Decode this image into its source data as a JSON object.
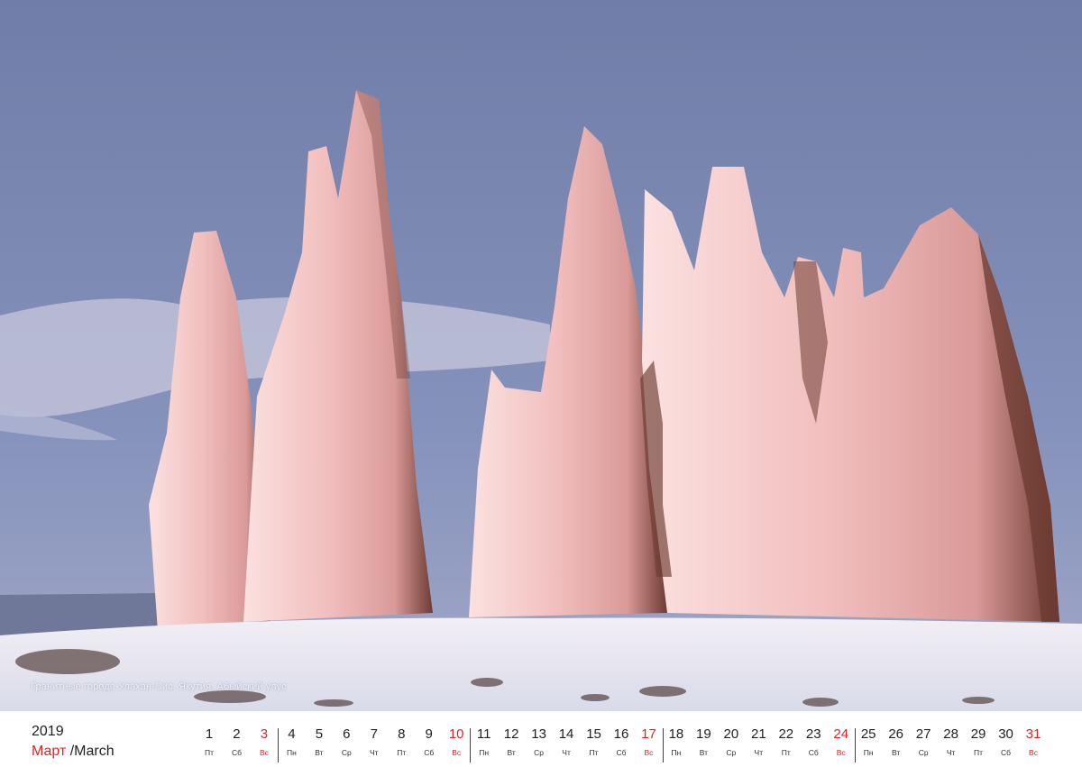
{
  "photo": {
    "caption": "Гранитные города Улахан-Сис. Якутия. Абыйский улус",
    "colors": {
      "sky": "#7f8cb4",
      "rock_lit": "#f3c4c4",
      "rock_dark": "#6b3a30",
      "snow": "#e8e8f2"
    }
  },
  "calendar": {
    "year": "2019",
    "month_ru": "Март",
    "month_en": "/March",
    "accent_color": "#d6262c",
    "days": [
      {
        "num": "1",
        "dow": "Пт"
      },
      {
        "num": "2",
        "dow": "Сб"
      },
      {
        "num": "3",
        "dow": "Вс"
      },
      {
        "num": "4",
        "dow": "Пн"
      },
      {
        "num": "5",
        "dow": "Вт"
      },
      {
        "num": "6",
        "dow": "Ср"
      },
      {
        "num": "7",
        "dow": "Чт"
      },
      {
        "num": "8",
        "dow": "Пт"
      },
      {
        "num": "9",
        "dow": "Сб"
      },
      {
        "num": "10",
        "dow": "Вс"
      },
      {
        "num": "11",
        "dow": "Пн"
      },
      {
        "num": "12",
        "dow": "Вт"
      },
      {
        "num": "13",
        "dow": "Ср"
      },
      {
        "num": "14",
        "dow": "Чт"
      },
      {
        "num": "15",
        "dow": "Пт"
      },
      {
        "num": "16",
        "dow": "Сб"
      },
      {
        "num": "17",
        "dow": "Вс"
      },
      {
        "num": "18",
        "dow": "Пн"
      },
      {
        "num": "19",
        "dow": "Вт"
      },
      {
        "num": "20",
        "dow": "Ср"
      },
      {
        "num": "21",
        "dow": "Чт"
      },
      {
        "num": "22",
        "dow": "Пт"
      },
      {
        "num": "23",
        "dow": "Сб"
      },
      {
        "num": "24",
        "dow": "Вс"
      },
      {
        "num": "25",
        "dow": "Пн"
      },
      {
        "num": "26",
        "dow": "Вт"
      },
      {
        "num": "27",
        "dow": "Ср"
      },
      {
        "num": "28",
        "dow": "Чт"
      },
      {
        "num": "29",
        "dow": "Пт"
      },
      {
        "num": "30",
        "dow": "Сб"
      },
      {
        "num": "31",
        "dow": "Вс"
      }
    ]
  }
}
